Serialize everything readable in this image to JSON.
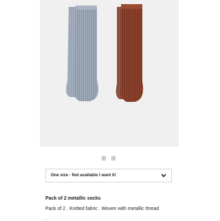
{
  "product": {
    "image_alt": "Two pairs of ribbed metallic socks, blue-grey and rust",
    "image_count": 2,
    "size_selector": {
      "value": "One size - Not available I want it!",
      "icon": "chevron-down-icon"
    },
    "title": "Pack of 2 metallic socks",
    "description": "Pack of 2 . Knitted fabric . Woven with metallic thread",
    "description_tail": "."
  },
  "colors": {
    "sock_blue": "#9aa6b6",
    "sock_rust": "#8a3f2a",
    "photo_bg": "#f1f0f0"
  }
}
